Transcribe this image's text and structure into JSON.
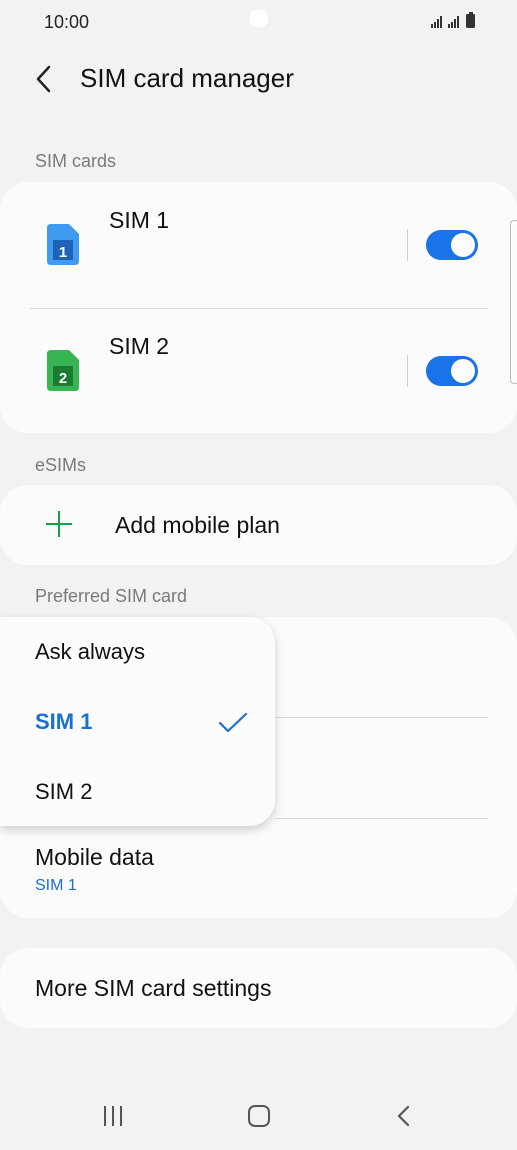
{
  "status_bar": {
    "time": "10:00"
  },
  "header": {
    "title": "SIM card manager"
  },
  "sim_cards": {
    "section_label": "SIM cards",
    "items": [
      {
        "name": "SIM 1",
        "number": "1",
        "icon_color": "#2f8ee8",
        "enabled": true
      },
      {
        "name": "SIM 2",
        "number": "2",
        "icon_color": "#2aa84a",
        "enabled": true
      }
    ]
  },
  "esims": {
    "section_label": "eSIMs",
    "add_label": "Add mobile plan"
  },
  "preferred": {
    "section_label": "Preferred SIM card",
    "mobile_data": {
      "label": "Mobile data",
      "value": "SIM 1"
    }
  },
  "popup": {
    "options": [
      {
        "label": "Ask always",
        "selected": false
      },
      {
        "label": "SIM 1",
        "selected": true
      },
      {
        "label": "SIM 2",
        "selected": false
      }
    ]
  },
  "more_settings": {
    "label": "More SIM card settings"
  },
  "colors": {
    "accent": "#1a6fd0",
    "toggle_on": "#1a73e8",
    "plus": "#14a04a"
  }
}
